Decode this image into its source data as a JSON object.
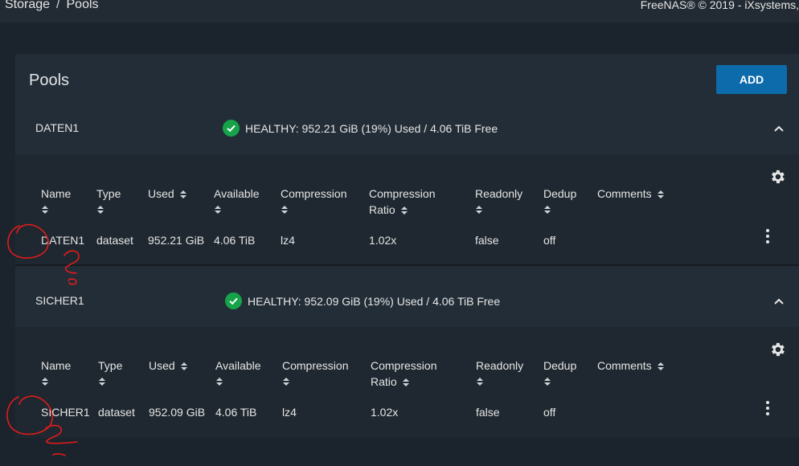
{
  "breadcrumb": {
    "items": [
      "Storage",
      "Pools"
    ],
    "separator": "/"
  },
  "footer": {
    "copyright": "FreeNAS® © 2019 - iXsystems,"
  },
  "page": {
    "title": "Pools",
    "add_label": "ADD"
  },
  "colors": {
    "accent": "#0e6bab",
    "healthy": "#16a34a",
    "annotation": "#e31b1b"
  },
  "columns": [
    "Name",
    "Type",
    "Used",
    "Available",
    "Compression",
    "Compression",
    "Ratio",
    "Readonly",
    "Dedup",
    "Comments"
  ],
  "pools": [
    {
      "name": "DATEN1",
      "status": "HEALTHY: 952.21 GiB (19%) Used / 4.06 TiB Free",
      "row": {
        "name": "DATEN1",
        "type": "dataset",
        "used": "952.21 GiB",
        "available": "4.06 TiB",
        "compression": "lz4",
        "ratio": "1.02x",
        "readonly": "false",
        "dedup": "off",
        "comments": ""
      }
    },
    {
      "name": "SICHER1",
      "status": "HEALTHY: 952.09 GiB (19%) Used / 4.06 TiB Free",
      "row": {
        "name": "SICHER1",
        "type": "dataset",
        "used": "952.09 GiB",
        "available": "4.06 TiB",
        "compression": "lz4",
        "ratio": "1.02x",
        "readonly": "false",
        "dedup": "off",
        "comments": ""
      }
    }
  ],
  "icons": {
    "status": "check-circle-icon",
    "collapse": "chevron-up-icon",
    "settings": "gear-icon",
    "actions": "more-vert-icon",
    "sort": "sort-icon"
  }
}
